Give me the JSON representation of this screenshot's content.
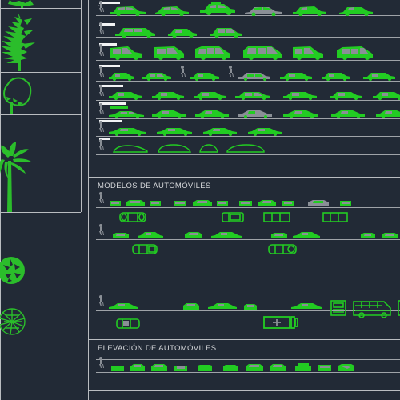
{
  "app": {
    "kind": "cad-block-catalog",
    "background_color": "#222a36",
    "line_color": "#b9bcc0",
    "vehicle_color": "#22cc22",
    "detail_color": "#8a8f96",
    "label_color": "#d6d8db"
  },
  "sections": [
    {
      "id": "side-views",
      "label": ""
    },
    {
      "id": "modelos",
      "label": "MODELOS DE AUTOMÓVILES"
    },
    {
      "id": "elevacion",
      "label": "ELEVACIÓN DE AUTOMÓVILES"
    }
  ],
  "sidebar": {
    "name": "vegetation-blocks-column",
    "cells": [
      {
        "name": "tree-partial-top",
        "icon": "tree-elevation-icon"
      },
      {
        "name": "conifer-tree",
        "icon": "pine-tree-elevation-icon"
      },
      {
        "name": "deciduous-tree",
        "icon": "tree-elevation-icon"
      },
      {
        "name": "palm-tree",
        "icon": "palm-tree-elevation-icon"
      },
      {
        "name": "tree-plan-dense",
        "icon": "tree-plan-icon"
      },
      {
        "name": "tree-plan-radial",
        "icon": "tree-plan-radial-icon"
      }
    ]
  },
  "side_view_rows": [
    {
      "name": "row-sedans-1",
      "tag_width": 26,
      "count": 6,
      "type": "sedan"
    },
    {
      "name": "row-sedans-2",
      "tag_width": 20,
      "count": 3,
      "type": "sedan"
    },
    {
      "name": "row-vans",
      "tag_width": 22,
      "count": 6,
      "type": "van"
    },
    {
      "name": "row-sedans-people",
      "tag_width": 26,
      "count": 8,
      "type": "sedan"
    },
    {
      "name": "row-sedans-3",
      "tag_width": 30,
      "count": 7,
      "type": "sedan"
    },
    {
      "name": "row-sports",
      "tag_width": 34,
      "count": 7,
      "type": "sport"
    },
    {
      "name": "row-sports-2",
      "tag_width": 28,
      "count": 4,
      "type": "sport"
    },
    {
      "name": "row-outlines",
      "tag_width": 14,
      "count": 4,
      "type": "outline"
    }
  ],
  "modelos_rows": [
    {
      "name": "modelos-row-1",
      "fronts": 11,
      "plans": 4
    },
    {
      "name": "modelos-row-2",
      "fronts": 8,
      "plans": 2
    },
    {
      "name": "modelos-row-3",
      "fronts": 8,
      "plans": 2
    }
  ],
  "elevacion_row": {
    "name": "elevacion-row-1",
    "count": 10
  }
}
